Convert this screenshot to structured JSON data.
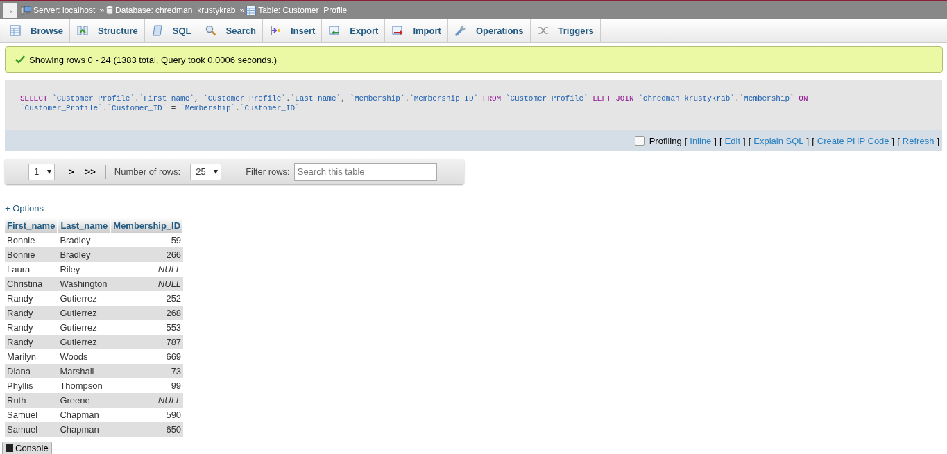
{
  "breadcrumb": {
    "toggle": "→",
    "items": [
      {
        "kind": "server",
        "text": "Server: localhost"
      },
      {
        "kind": "database",
        "text": "Database: chredman_krustykrab"
      },
      {
        "kind": "table",
        "text": "Table: Customer_Profile"
      }
    ],
    "separator": "»"
  },
  "tabs": [
    {
      "kind": "browse",
      "label": "Browse",
      "selected": false
    },
    {
      "kind": "structure",
      "label": "Structure",
      "selected": false
    },
    {
      "kind": "sql",
      "label": "SQL",
      "selected": false
    },
    {
      "kind": "search",
      "label": "Search",
      "selected": false
    },
    {
      "kind": "insert",
      "label": "Insert",
      "selected": false
    },
    {
      "kind": "export",
      "label": "Export",
      "selected": false
    },
    {
      "kind": "import",
      "label": "Import",
      "selected": false
    },
    {
      "kind": "operations",
      "label": "Operations",
      "selected": false
    },
    {
      "kind": "triggers",
      "label": "Triggers",
      "selected": false
    }
  ],
  "message": "Showing rows 0 - 24 (1383 total, Query took 0.0006 seconds.)",
  "sql_lines": [
    [
      {
        "kind": "keyword-underlined",
        "text": "SELECT"
      },
      {
        "kind": "identifier",
        "text": " `Customer_Profile`"
      },
      {
        "kind": "punct",
        "text": "."
      },
      {
        "kind": "identifier",
        "text": "`First_name`"
      },
      {
        "kind": "punct",
        "text": ", "
      },
      {
        "kind": "identifier",
        "text": "`Customer_Profile`"
      },
      {
        "kind": "punct",
        "text": "."
      },
      {
        "kind": "identifier",
        "text": "`Last_name`"
      },
      {
        "kind": "punct",
        "text": ", "
      },
      {
        "kind": "identifier",
        "text": "`Membership`"
      },
      {
        "kind": "punct",
        "text": "."
      },
      {
        "kind": "identifier",
        "text": "`Membership_ID`"
      },
      {
        "kind": "keyword",
        "text": " FROM"
      },
      {
        "kind": "identifier",
        "text": " `Customer_Profile` "
      },
      {
        "kind": "keyword-underlined",
        "text": "LEFT"
      },
      {
        "kind": "keyword",
        "text": " JOIN"
      },
      {
        "kind": "identifier",
        "text": " `chredman_krustykrab`"
      },
      {
        "kind": "punct",
        "text": "."
      },
      {
        "kind": "identifier",
        "text": "`Membership`"
      },
      {
        "kind": "keyword",
        "text": " ON"
      }
    ],
    [
      {
        "kind": "identifier",
        "text": "`Customer_Profile`"
      },
      {
        "kind": "punct",
        "text": "."
      },
      {
        "kind": "identifier",
        "text": "`Customer_ID`"
      },
      {
        "kind": "punct",
        "text": " = "
      },
      {
        "kind": "identifier",
        "text": "`Membership`"
      },
      {
        "kind": "punct",
        "text": "."
      },
      {
        "kind": "identifier",
        "text": "`Customer_ID`"
      }
    ]
  ],
  "profiling": {
    "label": "Profiling",
    "checked": false,
    "links": [
      {
        "open": "[",
        "text": "Inline",
        "close": "]"
      },
      {
        "open": "[",
        "text": "Edit",
        "close": "]"
      },
      {
        "open": "[",
        "text": "Explain SQL",
        "close": "]"
      },
      {
        "open": "[",
        "text": "Create PHP Code",
        "close": "]"
      },
      {
        "open": "[",
        "text": "Refresh",
        "close": "]"
      }
    ]
  },
  "navigation": {
    "page": "1",
    "next": ">",
    "last": ">>",
    "rows_label": "Number of rows:",
    "rows_value": "25",
    "filter_label": "Filter rows:",
    "filter_placeholder": "Search this table"
  },
  "options_link": "+ Options",
  "table": {
    "columns": [
      {
        "label": "First_name"
      },
      {
        "label": "Last_name"
      },
      {
        "label": "Membership_ID"
      }
    ],
    "rows": [
      {
        "cells": [
          "Bonnie",
          "Bradley",
          "59"
        ],
        "null": false
      },
      {
        "cells": [
          "Bonnie",
          "Bradley",
          "266"
        ],
        "null": false
      },
      {
        "cells": [
          "Laura",
          "Riley",
          "NULL"
        ],
        "null": true
      },
      {
        "cells": [
          "Christina",
          "Washington",
          "NULL"
        ],
        "null": true
      },
      {
        "cells": [
          "Randy",
          "Gutierrez",
          "252"
        ],
        "null": false
      },
      {
        "cells": [
          "Randy",
          "Gutierrez",
          "268"
        ],
        "null": false
      },
      {
        "cells": [
          "Randy",
          "Gutierrez",
          "553"
        ],
        "null": false
      },
      {
        "cells": [
          "Randy",
          "Gutierrez",
          "787"
        ],
        "null": false
      },
      {
        "cells": [
          "Marilyn",
          "Woods",
          "669"
        ],
        "null": false
      },
      {
        "cells": [
          "Diana",
          "Marshall",
          "73"
        ],
        "null": false
      },
      {
        "cells": [
          "Phyllis",
          "Thompson",
          "99"
        ],
        "null": false
      },
      {
        "cells": [
          "Ruth",
          "Greene",
          "NULL"
        ],
        "null": true
      },
      {
        "cells": [
          "Samuel",
          "Chapman",
          "590"
        ],
        "null": false
      },
      {
        "cells": [
          "Samuel",
          "Chapman",
          "650"
        ],
        "null": false
      }
    ]
  },
  "console": "Console"
}
